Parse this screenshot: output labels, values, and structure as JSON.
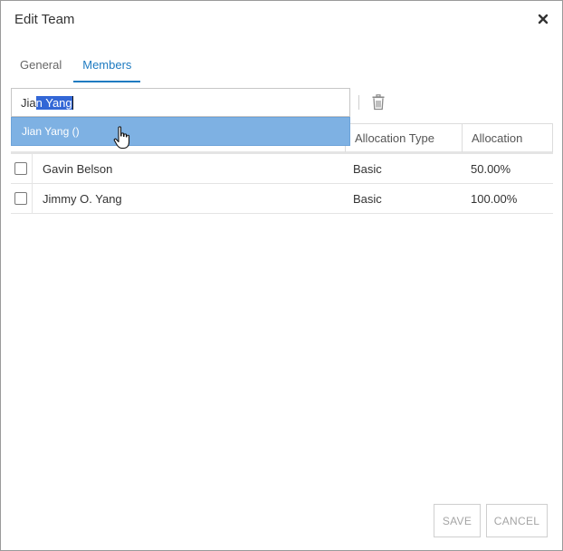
{
  "dialog": {
    "title": "Edit Team",
    "close_icon": "close-icon"
  },
  "tabs": [
    {
      "label": "General",
      "active": false
    },
    {
      "label": "Members",
      "active": true
    }
  ],
  "member_search": {
    "typed_text": "Jia",
    "autocomplete_selected_text": "n Yang",
    "dropdown_option": "Jian Yang ()"
  },
  "table": {
    "columns": [
      "Allocation Type",
      "Allocation"
    ],
    "rows": [
      {
        "name": "Gavin Belson",
        "allocation_type": "Basic",
        "allocation": "50.00%"
      },
      {
        "name": "Jimmy O. Yang",
        "allocation_type": "Basic",
        "allocation": "100.00%"
      }
    ]
  },
  "toolbar": {
    "delete_icon": "trash-icon"
  },
  "footer": {
    "save_label": "SAVE",
    "cancel_label": "CANCEL"
  },
  "colors": {
    "accent": "#1f7bc1",
    "dropdown_highlight": "#7eb1e3",
    "text_selection": "#3367d6"
  }
}
